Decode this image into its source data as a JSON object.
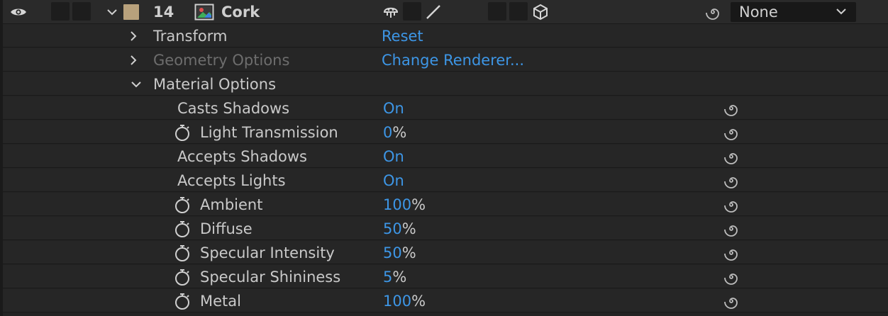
{
  "layer": {
    "number": "14",
    "name": "Cork",
    "color": "#b8a17c",
    "parent_dropdown": "None"
  },
  "groups": {
    "transform": {
      "label": "Transform",
      "action": "Reset"
    },
    "geometry": {
      "label": "Geometry Options",
      "action": "Change Renderer..."
    },
    "material": {
      "label": "Material Options"
    }
  },
  "props": [
    {
      "label": "Casts Shadows",
      "value": "On",
      "unit": "",
      "stopwatch": false
    },
    {
      "label": "Light Transmission",
      "value": "0",
      "unit": "%",
      "stopwatch": true
    },
    {
      "label": "Accepts Shadows",
      "value": "On",
      "unit": "",
      "stopwatch": false
    },
    {
      "label": "Accepts Lights",
      "value": "On",
      "unit": "",
      "stopwatch": false
    },
    {
      "label": "Ambient",
      "value": "100",
      "unit": "%",
      "stopwatch": true
    },
    {
      "label": "Diffuse",
      "value": "50",
      "unit": "%",
      "stopwatch": true
    },
    {
      "label": "Specular Intensity",
      "value": "50",
      "unit": "%",
      "stopwatch": true
    },
    {
      "label": "Specular Shininess",
      "value": "5",
      "unit": "%",
      "stopwatch": true
    },
    {
      "label": "Metal",
      "value": "100",
      "unit": "%",
      "stopwatch": true
    }
  ],
  "icons": {
    "visibility": "eye-icon",
    "expand": "chevron-down-icon",
    "layer_type": "image-layer-icon",
    "shy": "shy-icon",
    "fx": "fx-slash-icon",
    "threed": "cube-icon",
    "pickwhip": "pickwhip-spiral-icon",
    "stopwatch": "stopwatch-icon"
  }
}
